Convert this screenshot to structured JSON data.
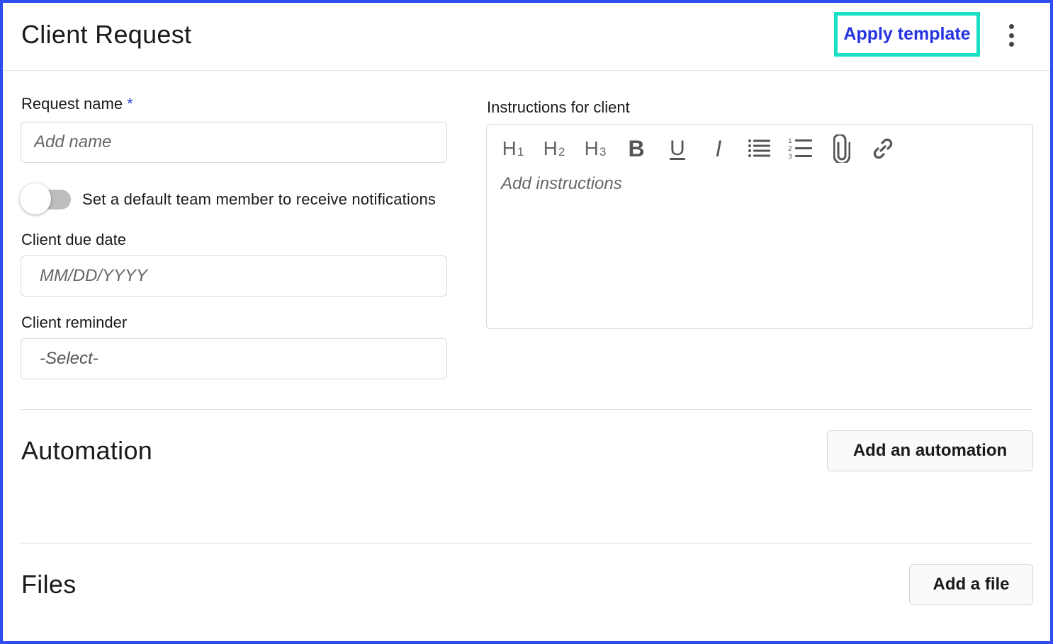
{
  "header": {
    "title": "Client Request",
    "apply_template_label": "Apply template"
  },
  "form": {
    "request_name": {
      "label": "Request name",
      "required_mark": "*",
      "placeholder": "Add name",
      "value": ""
    },
    "default_member_toggle": {
      "label": "Set a default team member to receive notifications",
      "checked": false
    },
    "due_date": {
      "label": "Client due date",
      "placeholder": "MM/DD/YYYY",
      "value": ""
    },
    "reminder": {
      "label": "Client reminder",
      "selected": "-Select-"
    }
  },
  "instructions": {
    "label": "Instructions for client",
    "placeholder": "Add instructions",
    "toolbar": {
      "h1": "H",
      "h1_sub": "1",
      "h2": "H",
      "h2_sub": "2",
      "h3": "H",
      "h3_sub": "3",
      "bold": "B",
      "underline": "U",
      "italic": "I",
      "icons": [
        "bulleted-list-icon",
        "numbered-list-icon",
        "paperclip-icon",
        "link-icon"
      ]
    }
  },
  "automation": {
    "title": "Automation",
    "add_label": "Add an automation"
  },
  "files": {
    "title": "Files",
    "add_label": "Add a file"
  },
  "colors": {
    "frame": "#2e4cf0",
    "highlight": "#18e0c4",
    "link": "#2634e0"
  }
}
